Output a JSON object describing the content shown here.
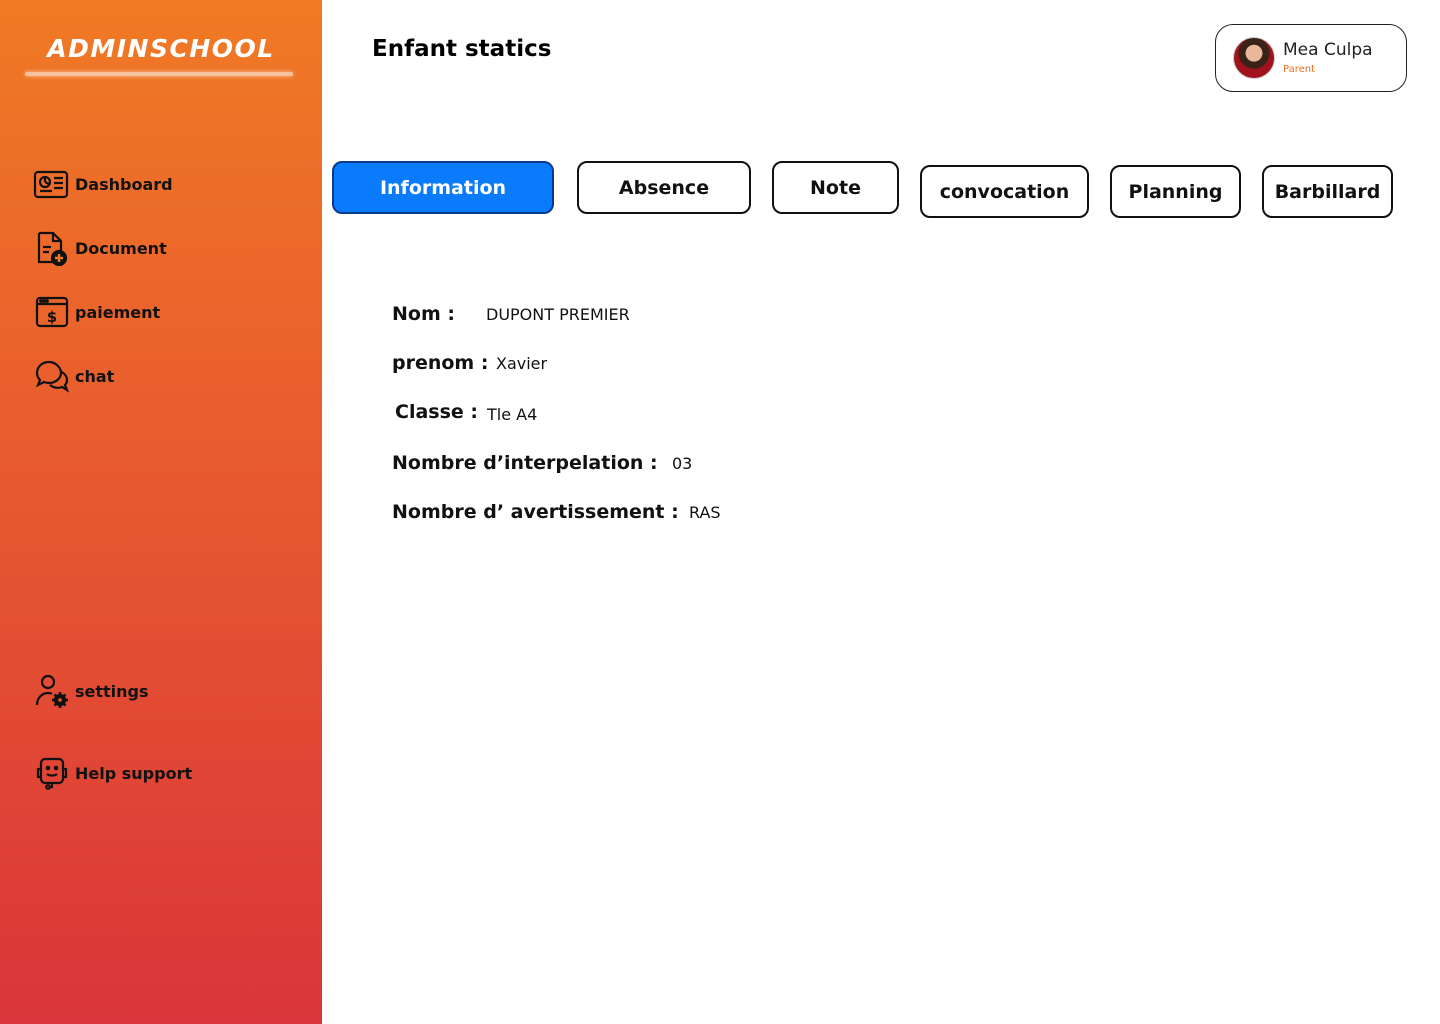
{
  "app": {
    "brand": "ADMINSCHOOL"
  },
  "header": {
    "title": "Enfant statics",
    "user": {
      "name": "Mea Culpa",
      "role": "Parent"
    }
  },
  "sidebar": {
    "items": [
      {
        "label": "Dashboard",
        "icon": "dashboard-icon"
      },
      {
        "label": "Document",
        "icon": "document-add-icon"
      },
      {
        "label": "paiement",
        "icon": "payment-icon"
      },
      {
        "label": "chat",
        "icon": "chat-icon"
      }
    ],
    "bottom_items": [
      {
        "label": "settings",
        "icon": "user-settings-icon"
      },
      {
        "label": "Help support",
        "icon": "help-support-icon"
      }
    ]
  },
  "tabs": [
    {
      "label": "Information",
      "active": true
    },
    {
      "label": "Absence",
      "active": false
    },
    {
      "label": "Note",
      "active": false
    },
    {
      "label": "convocation",
      "active": false
    },
    {
      "label": "Planning",
      "active": false
    },
    {
      "label": "Barbillard",
      "active": false
    }
  ],
  "info": {
    "fields": [
      {
        "label": "Nom :",
        "value": "DUPONT PREMIER"
      },
      {
        "label": "prenom :",
        "value": "Xavier"
      },
      {
        "label": "Classe :",
        "value": "Tle A4"
      },
      {
        "label": "Nombre d’interpelation :",
        "value": "03"
      },
      {
        "label": "Nombre d’ avertissement :",
        "value": "RAS"
      }
    ]
  },
  "colors": {
    "accent": "#0a7bfd",
    "sidebar_top": "#f07a24",
    "sidebar_bottom": "#d9353a",
    "role": "#e8702a"
  }
}
